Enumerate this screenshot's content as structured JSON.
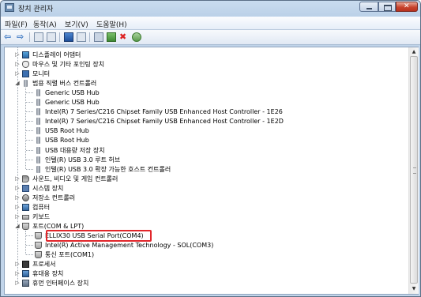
{
  "window": {
    "title": "장치 관리자"
  },
  "menubar": [
    {
      "key": "file",
      "label": "파일(F)"
    },
    {
      "key": "action",
      "label": "동작(A)"
    },
    {
      "key": "view",
      "label": "보기(V)"
    },
    {
      "key": "help",
      "label": "도움말(H)"
    }
  ],
  "toolbar": {
    "back_icon": "back-arrow-icon",
    "forward_icon": "forward-arrow-icon"
  },
  "tree": [
    {
      "label": "디스플레이 어댑터",
      "icon": "display-adapter-icon",
      "level": 1,
      "state": "collapsed"
    },
    {
      "label": "마우스 및 기타 포인팅 장치",
      "icon": "mouse-icon",
      "level": 1,
      "state": "collapsed"
    },
    {
      "label": "모니터",
      "icon": "monitor-icon",
      "level": 1,
      "state": "collapsed"
    },
    {
      "label": "범용 직렬 버스 컨트롤러",
      "icon": "usb-icon",
      "level": 1,
      "state": "expanded"
    },
    {
      "label": "Generic USB Hub",
      "icon": "usb-icon",
      "level": 2
    },
    {
      "label": "Generic USB Hub",
      "icon": "usb-icon",
      "level": 2
    },
    {
      "label": "Intel(R) 7 Series/C216 Chipset Family USB Enhanced Host Controller - 1E26",
      "icon": "usb-icon",
      "level": 2
    },
    {
      "label": "Intel(R) 7 Series/C216 Chipset Family USB Enhanced Host Controller - 1E2D",
      "icon": "usb-icon",
      "level": 2
    },
    {
      "label": "USB Root Hub",
      "icon": "usb-icon",
      "level": 2
    },
    {
      "label": "USB Root Hub",
      "icon": "usb-icon",
      "level": 2
    },
    {
      "label": "USB 대용량 저장 장치",
      "icon": "usb-icon",
      "level": 2
    },
    {
      "label": "인텔(R) USB 3.0 루트 허브",
      "icon": "usb-icon",
      "level": 2
    },
    {
      "label": "인텔(R) USB 3.0 확장 가능한 호스트 컨트롤러",
      "icon": "usb-icon",
      "level": 2
    },
    {
      "label": "사운드, 비디오 및 게임 컨트롤러",
      "icon": "sound-icon",
      "level": 1,
      "state": "collapsed"
    },
    {
      "label": "시스템 장치",
      "icon": "system-icon",
      "level": 1,
      "state": "collapsed"
    },
    {
      "label": "저장소 컨트롤러",
      "icon": "storage-icon",
      "level": 1,
      "state": "collapsed"
    },
    {
      "label": "컴퓨터",
      "icon": "computer-icon",
      "level": 1,
      "state": "collapsed"
    },
    {
      "label": "키보드",
      "icon": "keyboard-icon",
      "level": 1,
      "state": "collapsed"
    },
    {
      "label": "포트(COM & LPT)",
      "icon": "port-icon",
      "level": 1,
      "state": "expanded"
    },
    {
      "label": "ELLIX30 USB Serial Port(COM4)",
      "icon": "port-icon",
      "level": 2
    },
    {
      "label": "Intel(R) Active Management Technology - SOL(COM3)",
      "icon": "port-icon",
      "level": 2
    },
    {
      "label": "통신 포트(COM1)",
      "icon": "port-icon",
      "level": 2
    },
    {
      "label": "프로세서",
      "icon": "processor-icon",
      "level": 1,
      "state": "collapsed"
    },
    {
      "label": "휴대용 장치",
      "icon": "portable-device-icon",
      "level": 1,
      "state": "collapsed"
    },
    {
      "label": "휴먼 인터페이스 장치",
      "icon": "hid-icon",
      "level": 1,
      "state": "collapsed"
    }
  ],
  "colors": {
    "highlight": "#e1262b",
    "titlebar": "#b4cbe4",
    "close": "#c7442e"
  }
}
